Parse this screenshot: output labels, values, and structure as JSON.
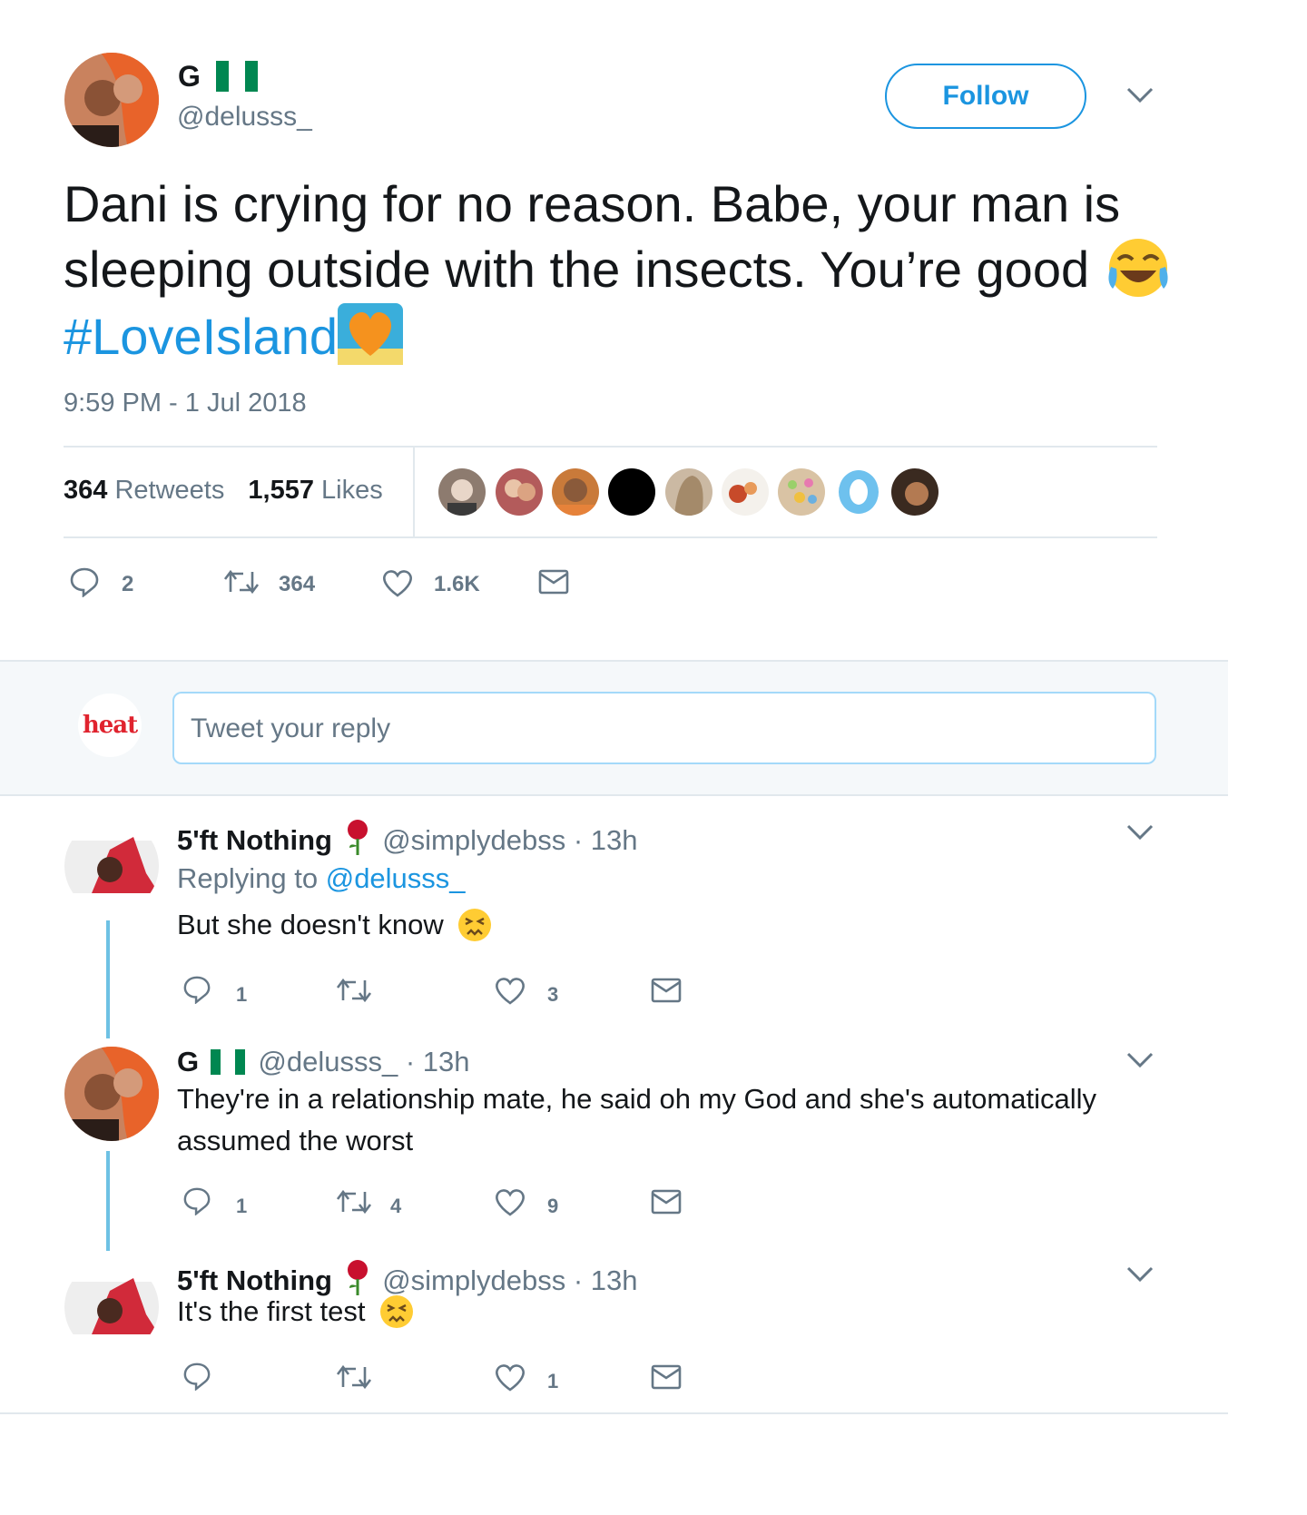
{
  "tweet": {
    "display_name": "G",
    "handle": "@delusss_",
    "follow_label": "Follow",
    "text_main": "Dani is crying for no reason. Babe, your man is sleeping outside with the insects. You’re good",
    "hashtag": "#LoveIsland",
    "timestamp": "9:59 PM - 1 Jul 2018",
    "retweets_count": "364",
    "retweets_label": "Retweets",
    "likes_count": "1,557",
    "likes_label": "Likes",
    "actions": {
      "replies": "2",
      "retweets": "364",
      "likes": "1.6K"
    }
  },
  "composer": {
    "avatar_text": "heat",
    "placeholder": "Tweet your reply"
  },
  "replies": [
    {
      "name": "5'ft Nothing",
      "handle": "@simplydebss",
      "time": "· 13h",
      "replying_prefix": "Replying to",
      "replying_handle": "@delusss_",
      "text": "But she doesn't know",
      "counts": {
        "replies": "1",
        "retweets": "",
        "likes": "3"
      }
    },
    {
      "name": "G",
      "handle": "@delusss_",
      "time": "· 13h",
      "text": "They're in a relationship mate, he said oh my God and she's automatically assumed the worst",
      "counts": {
        "replies": "1",
        "retweets": "4",
        "likes": "9"
      }
    },
    {
      "name": "5'ft Nothing",
      "handle": "@simplydebss",
      "time": "· 13h",
      "text": "It's the first test",
      "counts": {
        "replies": "",
        "retweets": "",
        "likes": "1"
      }
    }
  ],
  "colors": {
    "accent": "#1b95e0",
    "muted": "#657786",
    "composer_bg": "#f5f8fa",
    "thread_line": "#6ec1e4",
    "flag_green": "#008751"
  },
  "icons": [
    "reply-icon",
    "retweet-icon",
    "like-icon",
    "dm-icon",
    "chevron-down-icon",
    "rose-icon",
    "joy-emoji",
    "persevere-emoji",
    "heart-emoji"
  ]
}
